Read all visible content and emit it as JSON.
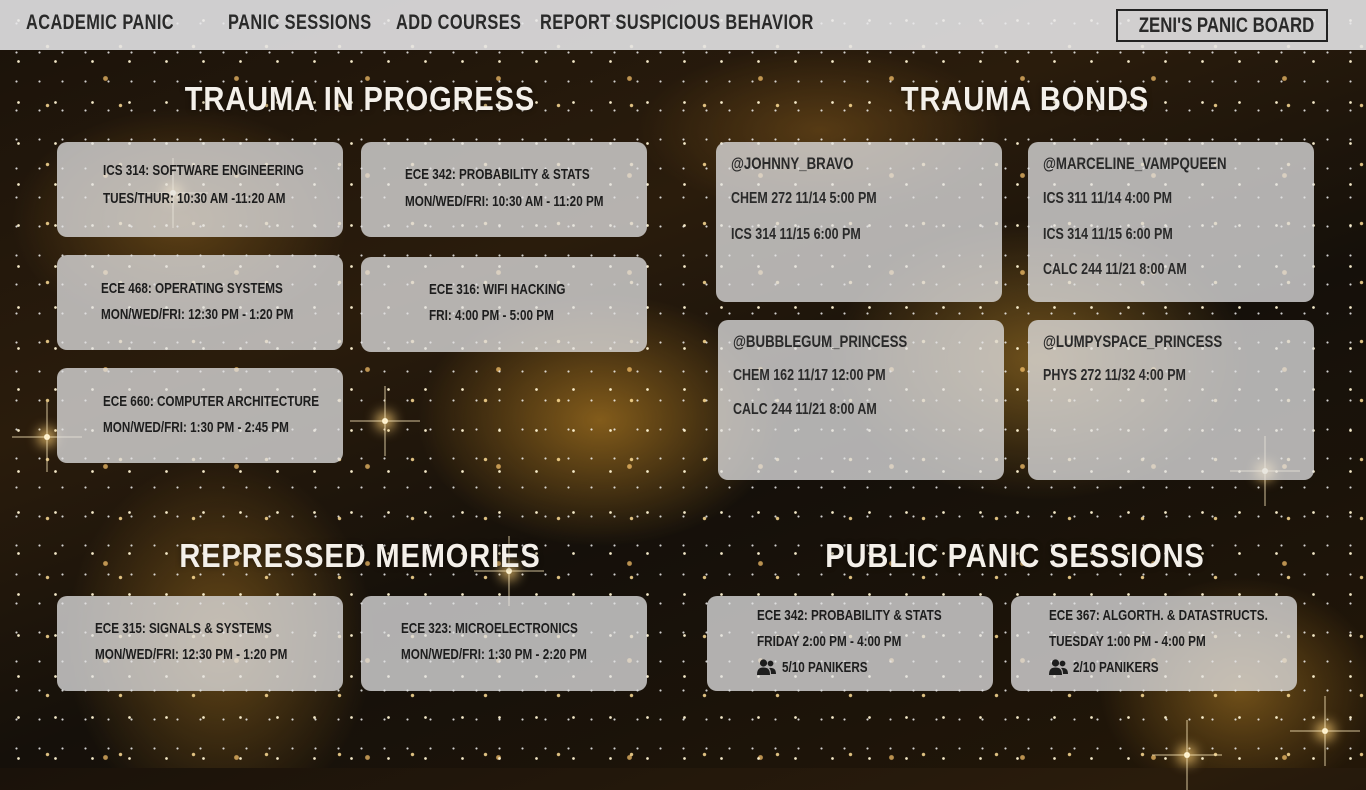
{
  "nav": {
    "brand": "Academic Panic",
    "items": [
      "Panic Sessions",
      "Add Courses",
      "Report Suspicious Behavior"
    ],
    "board_button": "Zeni's Panic Board"
  },
  "sections": {
    "in_progress": "Trauma in Progress",
    "bonds": "Trauma Bonds",
    "repressed": "Repressed Memories",
    "public": "Public Panic Sessions"
  },
  "in_progress_courses": [
    {
      "course": "ICS 314: Software Engineering",
      "schedule": "Tues/Thur: 10:30 AM -11:20 AM"
    },
    {
      "course": "ECE 342: Probability & Stats",
      "schedule": "Mon/Wed/Fri: 10:30 AM - 11:20 PM"
    },
    {
      "course": "ECE 468: Operating Systems",
      "schedule": "Mon/Wed/Fri: 12:30 PM - 1:20 PM"
    },
    {
      "course": "ECE 316: Wifi Hacking",
      "schedule": "Fri: 4:00 PM - 5:00 PM"
    },
    {
      "course": "ECE 660: Computer Architecture",
      "schedule": "Mon/Wed/Fri: 1:30 PM - 2:45 PM"
    }
  ],
  "bonds": [
    {
      "handle": "@johnny_bravo",
      "sessions": [
        "CHEM 272   11/14   5:00 PM",
        "ICS 314   11/15   6:00 PM"
      ]
    },
    {
      "handle": "@marceline_vampqueen",
      "sessions": [
        "ICS 311   11/14   4:00 PM",
        "ICS 314   11/15  6:00 PM",
        "CALC 244   11/21   8:00 AM"
      ]
    },
    {
      "handle": "@bubblegum_princess",
      "sessions": [
        "CHEM 162   11/17   12:00 PM",
        "CALC 244   11/21   8:00 AM"
      ]
    },
    {
      "handle": "@lumpyspace_princess",
      "sessions": [
        "PHYS 272   11/32   4:00 PM"
      ]
    }
  ],
  "repressed_courses": [
    {
      "course": "ECE 315: Signals & Systems",
      "schedule": "Mon/Wed/Fri: 12:30 PM - 1:20 PM"
    },
    {
      "course": "ECE 323: Microelectronics",
      "schedule": "Mon/Wed/Fri: 1:30 PM - 2:20 PM"
    }
  ],
  "public_sessions": [
    {
      "course": "ECE 342: Probability & Stats",
      "time": "Friday 2:00 PM - 4:00 PM",
      "icon": "people-icon",
      "count": "5/10 Panikers"
    },
    {
      "course": "ECE 367: Algorth. & DataStructs.",
      "time": "Tuesday 1:00 PM - 4:00 PM",
      "icon": "people-icon",
      "count": "2/10 Panikers"
    }
  ],
  "colors": {
    "nav_bg": "#e8e8eb",
    "card_bg": "#e2e2e4",
    "title_text": "#f4f0ea",
    "accent_gold": "#d6962a"
  }
}
